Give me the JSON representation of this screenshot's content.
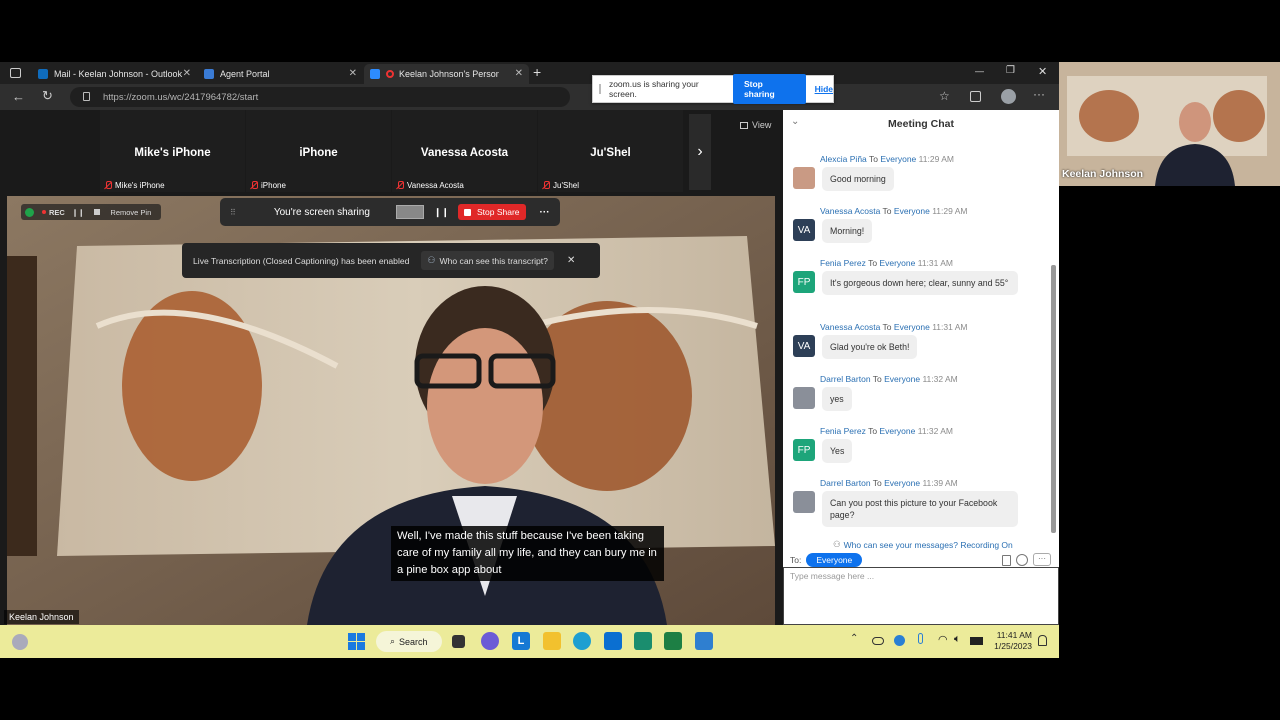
{
  "tabs": [
    {
      "label": "Mail - Keelan Johnson - Outlook",
      "close": "✕"
    },
    {
      "label": "Agent Portal",
      "close": "✕"
    },
    {
      "label": "Keelan Johnson's Personal M",
      "close": "✕"
    }
  ],
  "new_tab": "+",
  "window_controls": {
    "min": "—",
    "max": "❐",
    "close": "✕"
  },
  "address": "https://zoom.us/wc/2417964782/start",
  "share_notice": {
    "text": "zoom.us is sharing your screen.",
    "stop": "Stop sharing",
    "hide": "Hide"
  },
  "participants": [
    {
      "name": "Mike's iPhone",
      "sub": "Mike's iPhone"
    },
    {
      "name": "iPhone",
      "sub": "iPhone"
    },
    {
      "name": "Vanessa Acosta",
      "sub": "Vanessa Acosta"
    },
    {
      "name": "Ju'Shel",
      "sub": "Ju'Shel"
    }
  ],
  "view_label": "View",
  "rec": {
    "label": "REC",
    "remove_pin": "Remove Pin"
  },
  "sharing_bar": {
    "text": "You're screen sharing",
    "stop": "Stop Share",
    "more": "···"
  },
  "transcription": {
    "text": "Live Transcription (Closed Captioning) has been enabled",
    "who": "Who can see this transcript?",
    "close": "✕"
  },
  "caption": "Well, I've made this stuff because I've been taking care of my family all my life, and they can bury me in a pine box app about",
  "speaker": "Keelan Johnson",
  "self_view_name": "Keelan Johnson",
  "chat": {
    "title": "Meeting Chat",
    "to_word": "To",
    "messages": [
      {
        "name": "Alexcia Piña",
        "to": "Everyone",
        "time": "11:29 AM",
        "text": "Good morning",
        "avatar": ""
      },
      {
        "name": "Vanessa Acosta",
        "to": "Everyone",
        "time": "11:29 AM",
        "text": "Morning!",
        "avatar": "VA"
      },
      {
        "name": "Fenia Perez",
        "to": "Everyone",
        "time": "11:31 AM",
        "text": "It's gorgeous down here; clear, sunny and 55°",
        "avatar": "FP"
      },
      {
        "name": "Vanessa Acosta",
        "to": "Everyone",
        "time": "11:31 AM",
        "text": "Glad you're ok Beth!",
        "avatar": "VA"
      },
      {
        "name": "Darrel Barton",
        "to": "Everyone",
        "time": "11:32 AM",
        "text": "yes",
        "avatar": ""
      },
      {
        "name": "Fenia Perez",
        "to": "Everyone",
        "time": "11:32 AM",
        "text": "Yes",
        "avatar": "FP"
      },
      {
        "name": "Darrel Barton",
        "to": "Everyone",
        "time": "11:39 AM",
        "text": "Can you post this picture to your Facebook page?",
        "avatar": ""
      }
    ],
    "who_can_see": "Who can see your messages? Recording On",
    "to_label": "To:",
    "recipient": "Everyone",
    "placeholder": "Type message here ..."
  },
  "taskbar": {
    "search": "Search",
    "time": "11:41 AM",
    "date": "1/25/2023"
  },
  "colors": {
    "accent": "#0e72ed",
    "stop_red": "#e02828",
    "va_avatar": "#2d3f57",
    "fp_avatar": "#1da57a"
  }
}
